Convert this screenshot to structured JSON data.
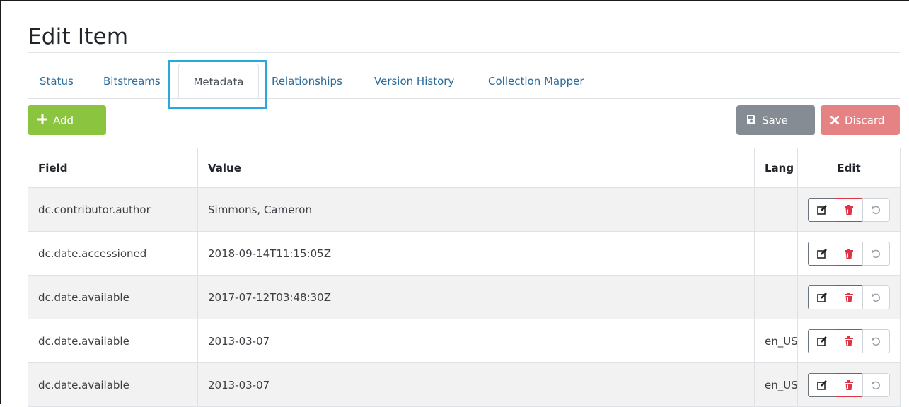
{
  "page": {
    "title": "Edit Item"
  },
  "tabs": [
    {
      "label": "Status"
    },
    {
      "label": "Bitstreams"
    },
    {
      "label": "Metadata",
      "active": true
    },
    {
      "label": "Relationships"
    },
    {
      "label": "Version History"
    },
    {
      "label": "Collection Mapper"
    }
  ],
  "toolbar": {
    "add_label": "Add",
    "save_label": "Save",
    "discard_label": "Discard"
  },
  "table": {
    "headers": {
      "field": "Field",
      "value": "Value",
      "lang": "Lang",
      "edit": "Edit"
    },
    "rows": [
      {
        "field": "dc.contributor.author",
        "value": "Simmons, Cameron",
        "lang": ""
      },
      {
        "field": "dc.date.accessioned",
        "value": "2018-09-14T11:15:05Z",
        "lang": ""
      },
      {
        "field": "dc.date.available",
        "value": "2017-07-12T03:48:30Z",
        "lang": ""
      },
      {
        "field": "dc.date.available",
        "value": "2013-03-07",
        "lang": "en_US"
      },
      {
        "field": "dc.date.available",
        "value": "2013-03-07",
        "lang": "en_US"
      }
    ]
  },
  "icons": {
    "add": "plus-icon",
    "save": "floppy-disk-icon",
    "discard": "x-icon",
    "edit": "edit-icon",
    "delete": "trash-icon",
    "undo": "undo-icon"
  },
  "colors": {
    "add": "#8bc43f",
    "save": "#858c93",
    "discard": "#e58283",
    "link": "#2b6c9a",
    "danger": "#dc3545",
    "highlight": "#29a8df"
  }
}
